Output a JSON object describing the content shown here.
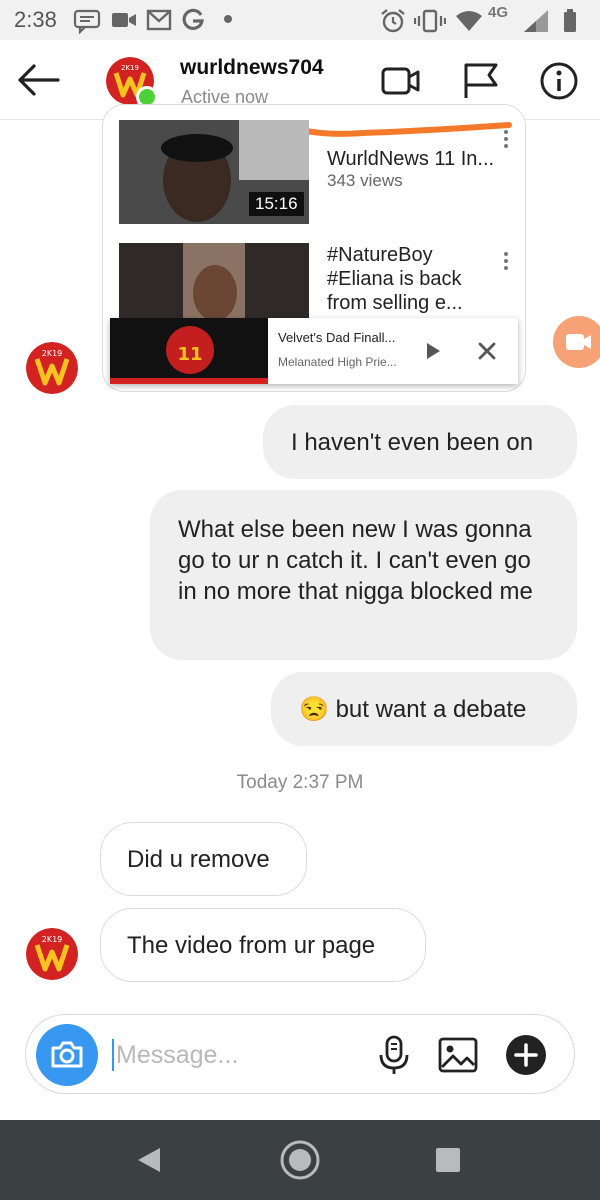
{
  "status_bar": {
    "time": "2:38",
    "network": "4G",
    "icons": [
      "message-icon",
      "video-icon",
      "gmail-icon",
      "google-icon",
      "dot-icon",
      "alarm-icon",
      "vibrate-icon",
      "wifi-icon",
      "signal-icon",
      "battery-icon"
    ]
  },
  "header": {
    "username": "wurldnews704",
    "status": "Active now",
    "avatar_text": "2K19",
    "icons": [
      "back-arrow-icon",
      "video-call-icon",
      "flag-icon",
      "info-icon"
    ]
  },
  "shared_post": {
    "videos": [
      {
        "title": "WurldNews 11 In...",
        "views": "343 views",
        "duration": "15:16"
      },
      {
        "title": "#NatureBoy #Eliana is back from selling e...",
        "duration": ""
      }
    ],
    "mini_player": {
      "title": "Velvet's Dad Finall...",
      "channel": "Melanated High Prie...",
      "logo_text": "11"
    }
  },
  "messages": {
    "m1": "I haven't even been on",
    "m2": "What else been new I was gonna go to ur n catch it. I can't even go in no more that nigga blocked me",
    "m3_emoji": "😒",
    "m3": "but want a debate",
    "timestamp": "Today 2:37 PM",
    "m4": "Did u remove",
    "m5": "The video from ur page"
  },
  "composer": {
    "placeholder": "Message..."
  },
  "colors": {
    "accent_blue": "#3897f0",
    "bubble_gray": "#efefef",
    "online_green": "#4cd137",
    "brand_red": "#d22222",
    "brand_yellow": "#f7c320",
    "navbar": "#3b4043"
  }
}
